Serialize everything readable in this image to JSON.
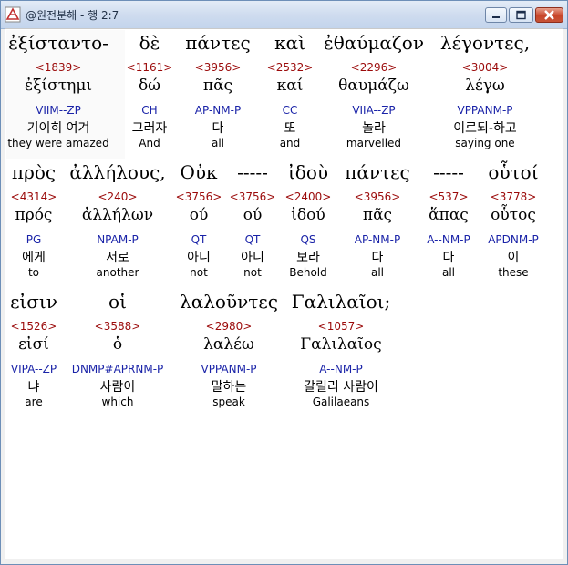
{
  "window": {
    "title": "@원전분해 - 행 2:7"
  },
  "colors": {
    "strong": "#9b0a0a",
    "parse": "#1a23a8"
  },
  "rows": [
    {
      "words": [
        {
          "greek": "ἐξίσταντο-",
          "strong": "<1839>",
          "lemma": "ἐξίστημι",
          "parse": "VIIM--ZP",
          "korean": "기이히 여겨",
          "english": "they were amazed"
        },
        {
          "greek": "δὲ",
          "strong": "<1161>",
          "lemma": "δώ",
          "parse": "CH",
          "korean": "그러자",
          "english": "And"
        },
        {
          "greek": "πάντες",
          "strong": "<3956>",
          "lemma": "πᾶς",
          "parse": "AP-NM-P",
          "korean": "다",
          "english": "all"
        },
        {
          "greek": "καὶ",
          "strong": "<2532>",
          "lemma": "καί",
          "parse": "CC",
          "korean": "또",
          "english": "and"
        },
        {
          "greek": "ἐθαύμαζον",
          "strong": "<2296>",
          "lemma": "θαυμάζω",
          "parse": "VIIA--ZP",
          "korean": "놀라",
          "english": "marvelled"
        },
        {
          "greek": "λέγοντες,",
          "strong": "<3004>",
          "lemma": "λέγω",
          "parse": "VPPANM-P",
          "korean": "이르되-하고",
          "english": "saying one"
        }
      ]
    },
    {
      "words": [
        {
          "greek": "πρὸς",
          "strong": "<4314>",
          "lemma": "πρός",
          "parse": "PG",
          "korean": "에게",
          "english": "to"
        },
        {
          "greek": "ἀλλήλους,",
          "strong": "<240>",
          "lemma": "ἀλλήλων",
          "parse": "NPAM-P",
          "korean": "서로",
          "english": "another"
        },
        {
          "greek": "Οὐκ",
          "strong": "<3756>",
          "lemma": "ού",
          "parse": "QT",
          "korean": "아니",
          "english": "not"
        },
        {
          "greek": "-----",
          "strong": "<3756>",
          "lemma": "ού",
          "parse": "QT",
          "korean": "아니",
          "english": "not"
        },
        {
          "greek": "ἰδοὺ",
          "strong": "<2400>",
          "lemma": "ἰδού",
          "parse": "QS",
          "korean": "보라",
          "english": "Behold"
        },
        {
          "greek": "πάντες",
          "strong": "<3956>",
          "lemma": "πᾶς",
          "parse": "AP-NM-P",
          "korean": "다",
          "english": "all"
        },
        {
          "greek": "-----",
          "strong": "<537>",
          "lemma": "ἅπας",
          "parse": "A--NM-P",
          "korean": "다",
          "english": "all"
        },
        {
          "greek": "οὗτοί",
          "strong": "<3778>",
          "lemma": "οὗτος",
          "parse": "APDNM-P",
          "korean": "이",
          "english": "these"
        }
      ]
    },
    {
      "words": [
        {
          "greek": "εἰσιν",
          "strong": "<1526>",
          "lemma": "εἰσί",
          "parse": "VIPA--ZP",
          "korean": "냐",
          "english": "are"
        },
        {
          "greek": "οἱ",
          "strong": "<3588>",
          "lemma": "ὁ",
          "parse": "DNMP#APRNM-P",
          "korean": "사람이",
          "english": "which"
        },
        {
          "greek": "λαλοῦντες",
          "strong": "<2980>",
          "lemma": "λαλέω",
          "parse": "VPPANM-P",
          "korean": "말하는",
          "english": "speak"
        },
        {
          "greek": "Γαλιλαῖοι;",
          "strong": "<1057>",
          "lemma": "Γαλιλαῖος",
          "parse": "A--NM-P",
          "korean": "갈릴리 사람이",
          "english": "Galilaeans"
        }
      ]
    }
  ]
}
